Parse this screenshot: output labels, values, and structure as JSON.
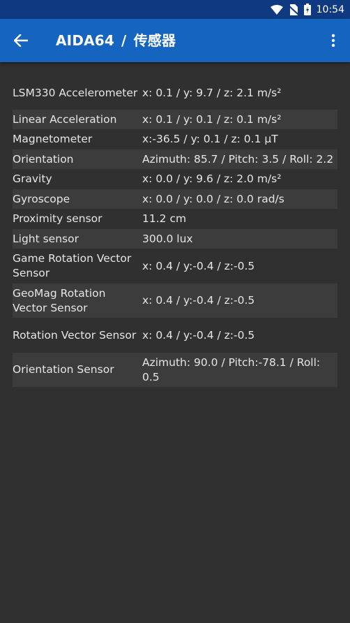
{
  "status_bar": {
    "time": "10:54"
  },
  "app_bar": {
    "title": "AIDA64",
    "separator": "/",
    "subtitle": "传感器"
  },
  "rows": [
    {
      "label": "LSM330 Accelerometer",
      "value": "x: 0.1 / y: 9.7 / z: 2.1 m/s²"
    },
    {
      "label": "Linear Acceleration",
      "value": "x: 0.1 / y: 0.1 / z: 0.1 m/s²"
    },
    {
      "label": "Magnetometer",
      "value": "x:-36.5 / y: 0.1 / z: 0.1 µT"
    },
    {
      "label": "Orientation",
      "value": "Azimuth: 85.7 / Pitch: 3.5 / Roll: 2.2"
    },
    {
      "label": "Gravity",
      "value": "x: 0.0 / y: 9.6 / z: 2.0 m/s²"
    },
    {
      "label": "Gyroscope",
      "value": "x: 0.0 / y: 0.0 / z: 0.0 rad/s"
    },
    {
      "label": "Proximity sensor",
      "value": "11.2 cm"
    },
    {
      "label": "Light sensor",
      "value": "300.0 lux"
    },
    {
      "label": "Game Rotation Vector Sensor",
      "value": "x: 0.4 / y:-0.4 / z:-0.5"
    },
    {
      "label": "GeoMag Rotation Vector Sensor",
      "value": "x: 0.4 / y:-0.4 / z:-0.5"
    },
    {
      "label": "Rotation Vector Sensor",
      "value": "x: 0.4 / y:-0.4 / z:-0.5"
    },
    {
      "label": "Orientation Sensor",
      "value": "Azimuth: 90.0 / Pitch:-78.1 / Roll: 0.5"
    }
  ]
}
